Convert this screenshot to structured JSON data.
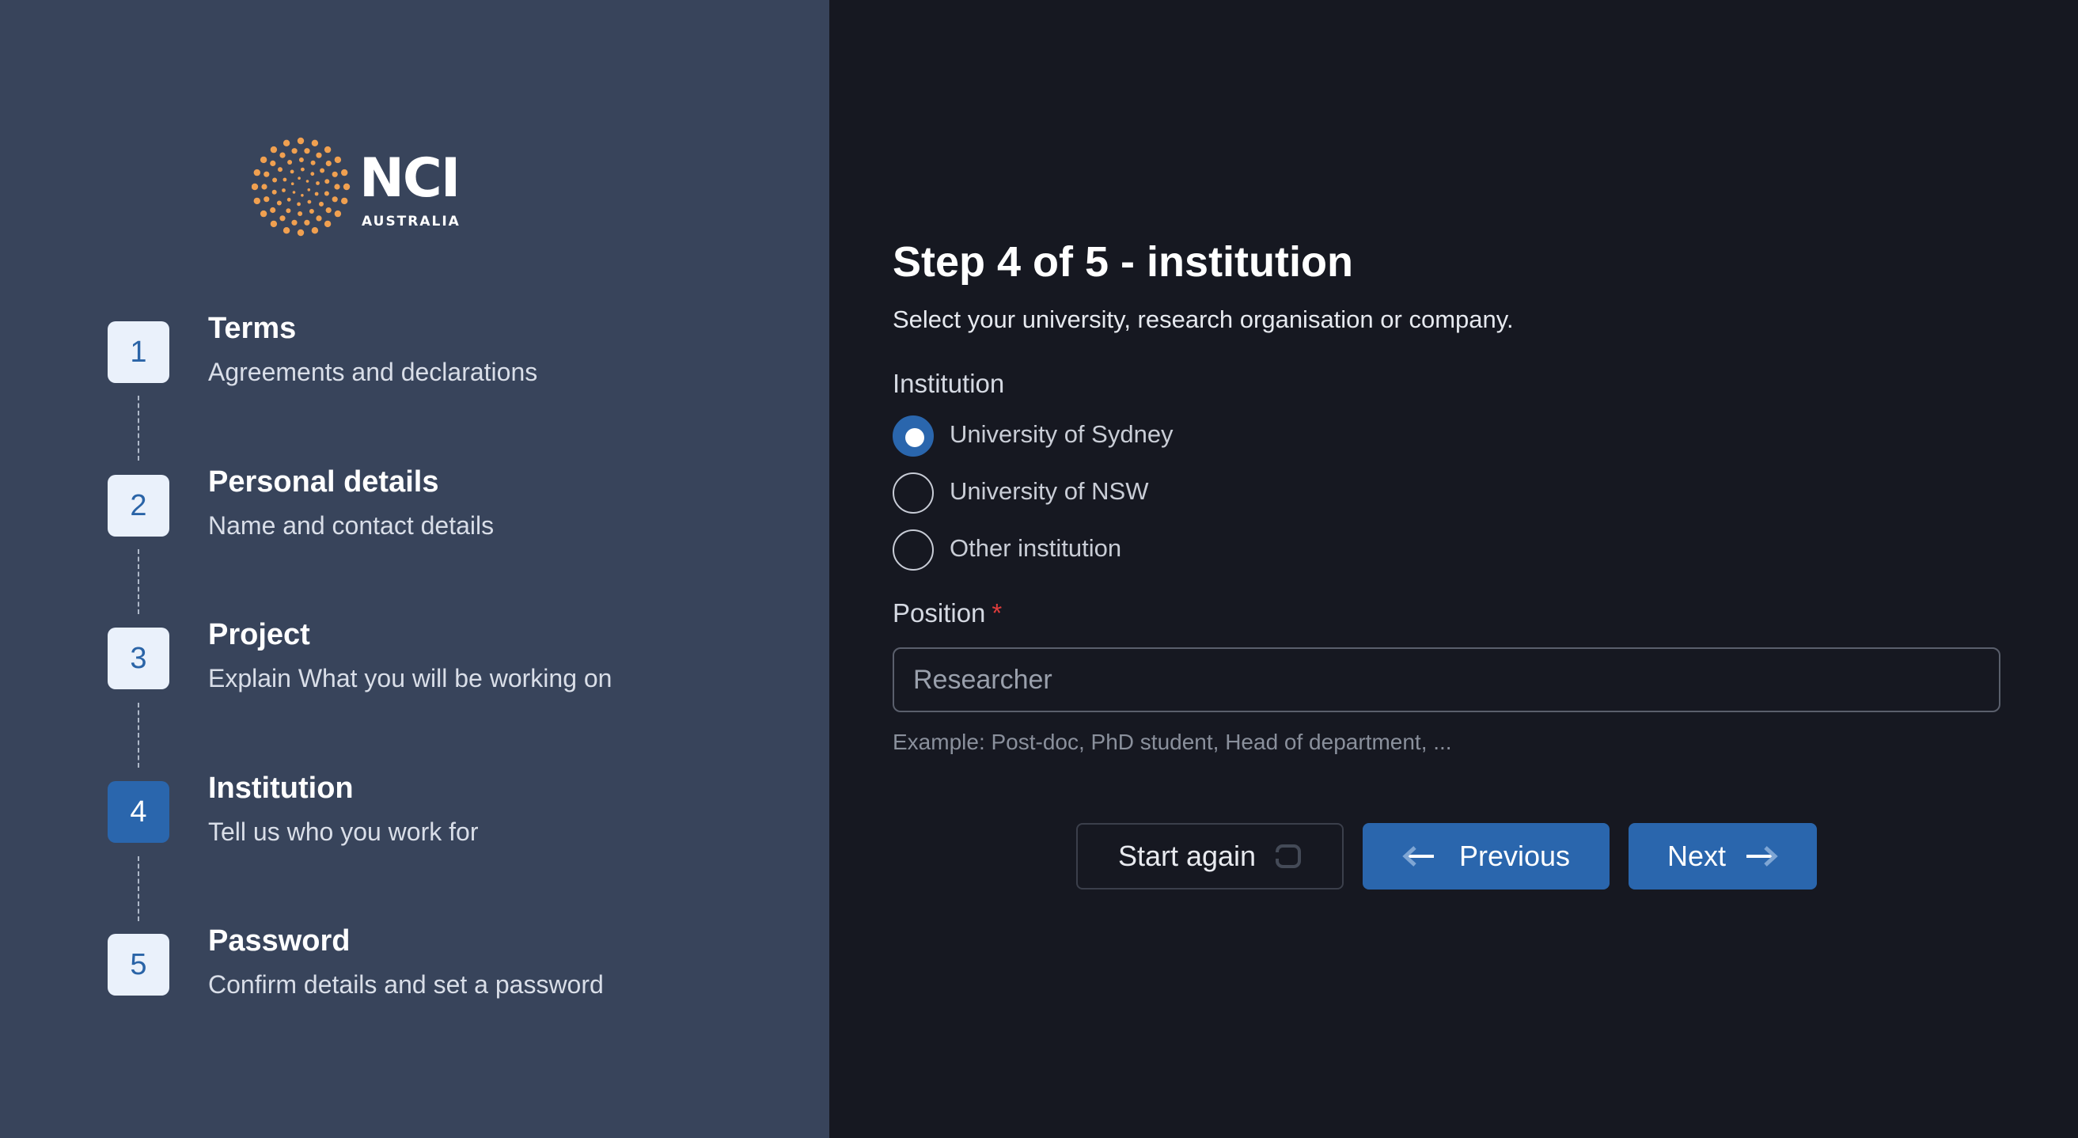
{
  "brand": {
    "name": "NCI",
    "subtitle": "AUSTRALIA",
    "accent_color": "#f0a050"
  },
  "steps": [
    {
      "number": "1",
      "title": "Terms",
      "description": "Agreements and declarations",
      "active": false
    },
    {
      "number": "2",
      "title": "Personal details",
      "description": "Name and contact details",
      "active": false
    },
    {
      "number": "3",
      "title": "Project",
      "description": "Explain What you will be working on",
      "active": false
    },
    {
      "number": "4",
      "title": "Institution",
      "description": "Tell us who you work for",
      "active": true
    },
    {
      "number": "5",
      "title": "Password",
      "description": "Confirm details and set a password",
      "active": false
    }
  ],
  "form": {
    "title": "Step 4 of 5 - institution",
    "subtitle": "Select your university, research organisation or company.",
    "institution": {
      "label": "Institution",
      "options": [
        {
          "label": "University of Sydney",
          "selected": true
        },
        {
          "label": "University of NSW",
          "selected": false
        },
        {
          "label": "Other institution",
          "selected": false
        }
      ]
    },
    "position": {
      "label": "Position",
      "required_marker": "*",
      "value": "",
      "placeholder": "Researcher",
      "hint": "Example: Post-doc, PhD student, Head of department, ..."
    }
  },
  "actions": {
    "start_again": "Start again",
    "previous": "Previous",
    "next": "Next"
  },
  "colors": {
    "sidebar_bg": "#38445b",
    "main_bg": "#161821",
    "primary": "#2a66ad",
    "required": "#e03c3c"
  }
}
